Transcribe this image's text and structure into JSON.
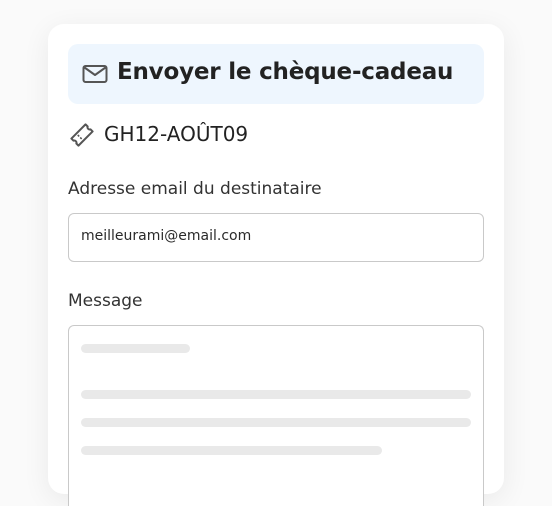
{
  "dialog": {
    "title": "Envoyer le chèque-cadeau",
    "header_icon": "mail-icon",
    "header_bg": "#eef6fe"
  },
  "voucher": {
    "icon": "ticket-tag-icon",
    "code": "GH12-AOÛT09"
  },
  "form": {
    "email_label": "Adresse email du destinataire",
    "email_value": "meilleurami@email.com",
    "message_label": "Message"
  }
}
